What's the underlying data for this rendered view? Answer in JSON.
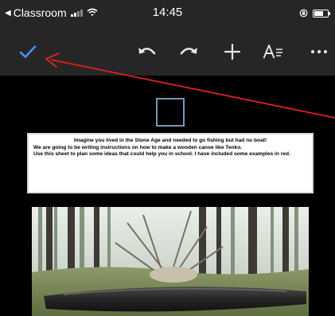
{
  "status_bar": {
    "back_app": "Classroom",
    "time": "14:45"
  },
  "toolbar": {
    "done_icon": "checkmark-icon",
    "undo_icon": "undo-icon",
    "redo_icon": "redo-icon",
    "insert_icon": "plus-icon",
    "format_icon": "text-format-icon",
    "more_icon": "more-horizontal-icon",
    "accent_color": "#4f8ff7"
  },
  "annotation": {
    "arrow_color": "#e02020"
  },
  "document": {
    "textbox": {
      "line1": "Imagine you lived in the Stone Age and needed to go fishing but had no boat!",
      "line2": "We are going to be writing instructions on how to make a wooden canoe like Tenko.",
      "line3": "Use this sheet to plan some ideas that could help you in school. I have included some examples in red."
    }
  }
}
